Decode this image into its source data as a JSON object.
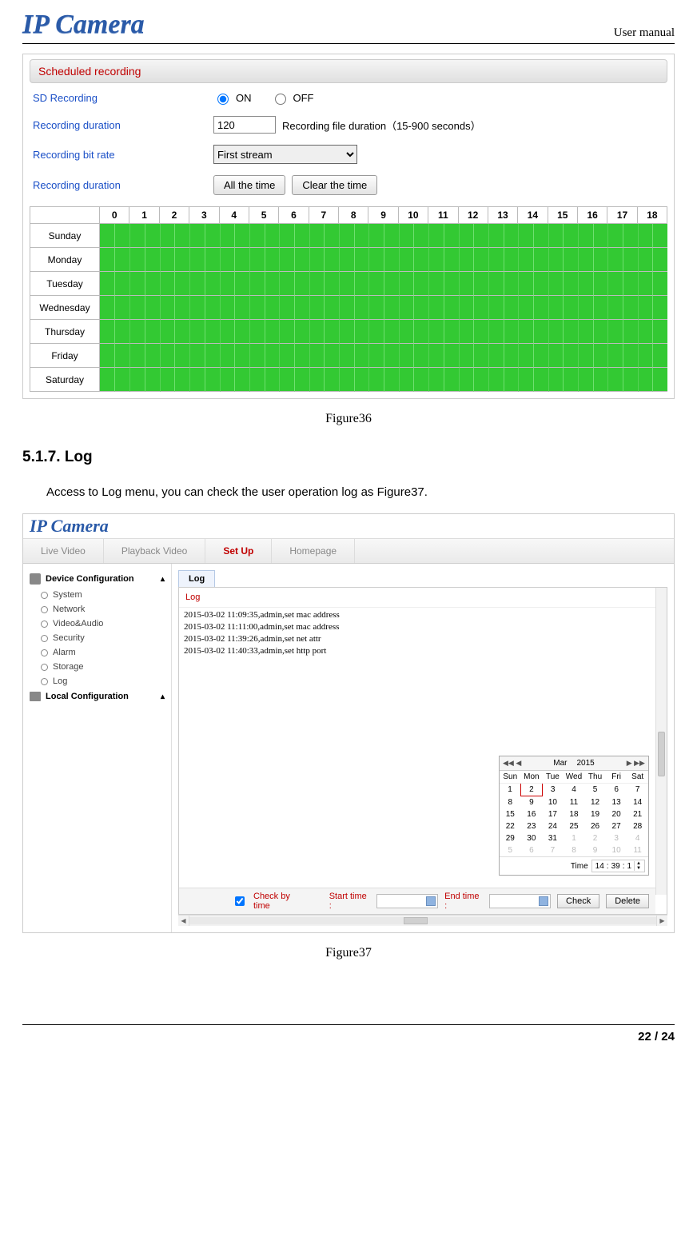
{
  "header": {
    "logo": "IP Camera",
    "right": "User manual"
  },
  "fig36": {
    "section_title": "Scheduled recording",
    "rows": {
      "sd_recording_label": "SD Recording",
      "on_label": "ON",
      "off_label": "OFF",
      "recording_duration_label": "Recording duration",
      "duration_value": "120",
      "duration_hint": "Recording file duration（15-900 seconds）",
      "bit_rate_label": "Recording bit rate",
      "bit_rate_value": "First stream",
      "recording_duration2_label": "Recording duration",
      "btn_all": "All the time",
      "btn_clear": "Clear the time"
    },
    "hours": [
      "0",
      "1",
      "2",
      "3",
      "4",
      "5",
      "6",
      "7",
      "8",
      "9",
      "10",
      "11",
      "12",
      "13",
      "14",
      "15",
      "16",
      "17",
      "18"
    ],
    "days": [
      "Sunday",
      "Monday",
      "Tuesday",
      "Wednesday",
      "Thursday",
      "Friday",
      "Saturday"
    ],
    "caption": "Figure36"
  },
  "section": {
    "heading": "5.1.7.  Log",
    "text": "Access to Log menu, you can check the user operation log as Figure37."
  },
  "fig37": {
    "logo": "IP Camera",
    "tabs": [
      "Live Video",
      "Playback Video",
      "Set Up",
      "Homepage"
    ],
    "active_tab_index": 2,
    "sidebar": {
      "group1": {
        "title": "Device Configuration",
        "items": [
          "System",
          "Network",
          "Video&Audio",
          "Security",
          "Alarm",
          "Storage",
          "Log"
        ]
      },
      "group2": {
        "title": "Local Configuration"
      }
    },
    "log_tab_label": "Log",
    "log_header": "Log",
    "log_lines": [
      "2015-03-02 11:09:35,admin,set mac address",
      "2015-03-02 11:11:00,admin,set mac address",
      "2015-03-02 11:39:26,admin,set net attr",
      "2015-03-02 11:40:33,admin,set http port"
    ],
    "calendar": {
      "month": "Mar",
      "year": "2015",
      "dow": [
        "Sun",
        "Mon",
        "Tue",
        "Wed",
        "Thu",
        "Fri",
        "Sat"
      ],
      "weeks": [
        [
          "1",
          "2",
          "3",
          "4",
          "5",
          "6",
          "7"
        ],
        [
          "8",
          "9",
          "10",
          "11",
          "12",
          "13",
          "14"
        ],
        [
          "15",
          "16",
          "17",
          "18",
          "19",
          "20",
          "21"
        ],
        [
          "22",
          "23",
          "24",
          "25",
          "26",
          "27",
          "28"
        ],
        [
          "29",
          "30",
          "31",
          "1",
          "2",
          "3",
          "4"
        ],
        [
          "5",
          "6",
          "7",
          "8",
          "9",
          "10",
          "11"
        ]
      ],
      "other_rows_start": 4,
      "selected": [
        0,
        1
      ],
      "time_label": "Time",
      "time_value": [
        "14",
        "39",
        "1"
      ]
    },
    "filter": {
      "check_label": "Check by time",
      "start_label": "Start time :",
      "end_label": "End time :",
      "check_btn": "Check",
      "delete_btn": "Delete"
    },
    "caption": "Figure37"
  },
  "footer": "22 / 24"
}
